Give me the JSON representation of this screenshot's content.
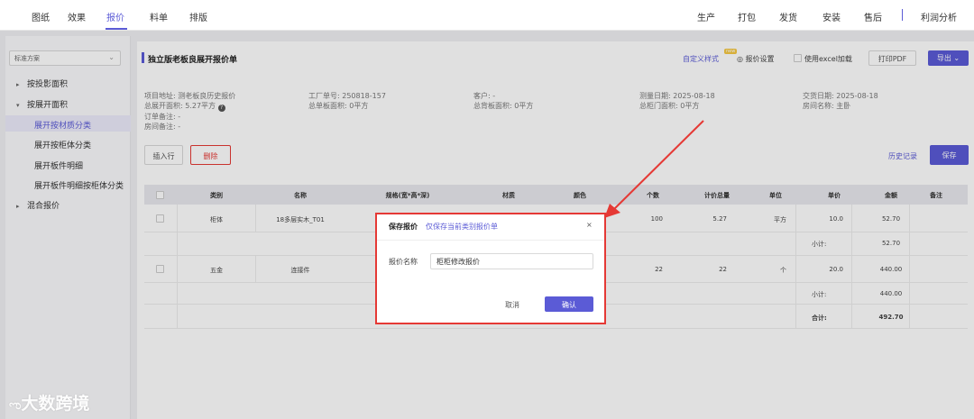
{
  "topnav": {
    "left_items": [
      "图纸",
      "效果",
      "报价",
      "料单",
      "排版"
    ],
    "active_index": 2,
    "right_items": [
      "生产",
      "打包",
      "发货",
      "安装",
      "售后"
    ],
    "profit": "利润分析"
  },
  "sidebar": {
    "scheme": "标准方案",
    "items": [
      {
        "label": "按投影面积",
        "arrow": "▸"
      },
      {
        "label": "按展开面积",
        "arrow": "▾"
      },
      {
        "label": "展开按材质分类",
        "arrow": ""
      },
      {
        "label": "展开按柜体分类",
        "arrow": ""
      },
      {
        "label": "展开板件明细",
        "arrow": ""
      },
      {
        "label": "展开板件明细按柜体分类",
        "arrow": ""
      },
      {
        "label": "混合报价",
        "arrow": "▸"
      }
    ]
  },
  "main": {
    "title": "独立版老板良展开报价单",
    "custom_style": "自定义样式",
    "new_badge": "new",
    "quote_settings": "报价设置",
    "use_excel": "使用excel加载",
    "print_pdf": "打印PDF",
    "export": "导出",
    "info": {
      "address": "项目地址: 测老板良历史报价",
      "total_area": "总展开面积: 5.27平方",
      "order_note": "订单备注: -",
      "room_note": "房间备注: -",
      "factory_no": "工厂单号: 250818-157",
      "single_area": "总单板面积: 0平方",
      "customer": "客户: -",
      "back_area": "总背板面积: 0平方",
      "measure_date": "测量日期: 2025-08-18",
      "door_area": "总柜门面积: 0平方",
      "delivery_date": "交货日期: 2025-08-18",
      "room_name": "房间名称: 主卧"
    },
    "insert_row": "插入行",
    "delete": "删除",
    "history": "历史记录",
    "save": "保存"
  },
  "table": {
    "headers": [
      "类别",
      "名称",
      "规格(宽*高*深)",
      "材质",
      "颜色",
      "个数",
      "计价总量",
      "单位",
      "单价",
      "金额",
      "备注"
    ],
    "rows": [
      {
        "category": "柜体",
        "name": "18多层实木_T01",
        "qty": "100",
        "total": "5.27",
        "unit": "平方",
        "price": "10.0",
        "amount": "52.70"
      },
      {
        "category": "五金",
        "name": "连接件",
        "qty": "22",
        "total": "22",
        "unit": "个",
        "price": "20.0",
        "amount": "440.00"
      }
    ],
    "subtotal_label": "小计:",
    "subtotals": [
      "52.70",
      "440.00"
    ],
    "total_label": "合计:",
    "total": "492.70"
  },
  "dialog": {
    "title": "保存报价",
    "subtitle": "仅保存当前类别报价单",
    "close": "×",
    "label": "报价名称",
    "value": "柜柜修改报价",
    "cancel": "取消",
    "confirm": "确认"
  },
  "logo": "大数跨境",
  "colors": {
    "accent": "#5b5bd6",
    "danger": "#e53935"
  }
}
